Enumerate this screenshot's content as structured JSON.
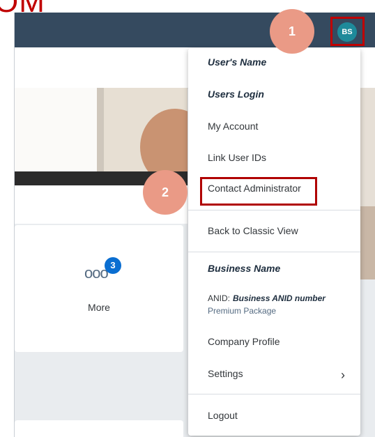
{
  "header": {
    "title_fragment": "OM"
  },
  "profile": {
    "initials": "BS",
    "avatar_color": "#1e8a9a"
  },
  "steps": {
    "one": "1",
    "two": "2"
  },
  "more": {
    "badge": "3",
    "label": "More",
    "dots": "ooo"
  },
  "menu": {
    "user_name": "User's Name",
    "user_login": "Users Login",
    "my_account": "My Account",
    "link_user_ids": "Link User IDs",
    "contact_admin": "Contact Administrator",
    "classic_view": "Back to Classic View",
    "business_name": "Business Name",
    "anid_label": "ANID:",
    "anid_value": "Business ANID number",
    "package": "Premium Package",
    "company_profile": "Company Profile",
    "settings": "Settings",
    "logout": "Logout"
  },
  "colors": {
    "topbar": "#354a5f",
    "highlight": "#c00000",
    "marker": "#ea9a86",
    "badge": "#0a6ed1"
  }
}
